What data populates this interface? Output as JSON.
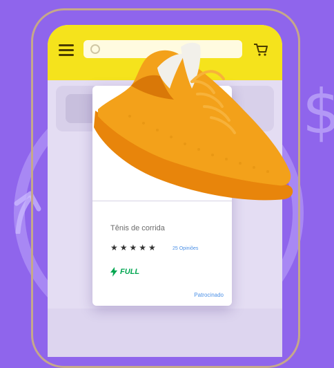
{
  "product_card": {
    "title": "Tênis de corrida",
    "stars": "★★★★★",
    "reviews_text": "25 Opiniões",
    "shipping_badge": "FULL",
    "sponsored_label": "Patrocinado"
  },
  "decorations": {
    "currency_symbol": "$"
  },
  "colors": {
    "background": "#8f65ec",
    "topbar": "#f5e31c",
    "shoe": "#f3a11a",
    "full_green": "#00a650",
    "link_blue": "#4a8fe6"
  },
  "icons": [
    "menu-icon",
    "search-icon",
    "cart-icon",
    "lightning-icon",
    "refresh-arrow-icon"
  ]
}
